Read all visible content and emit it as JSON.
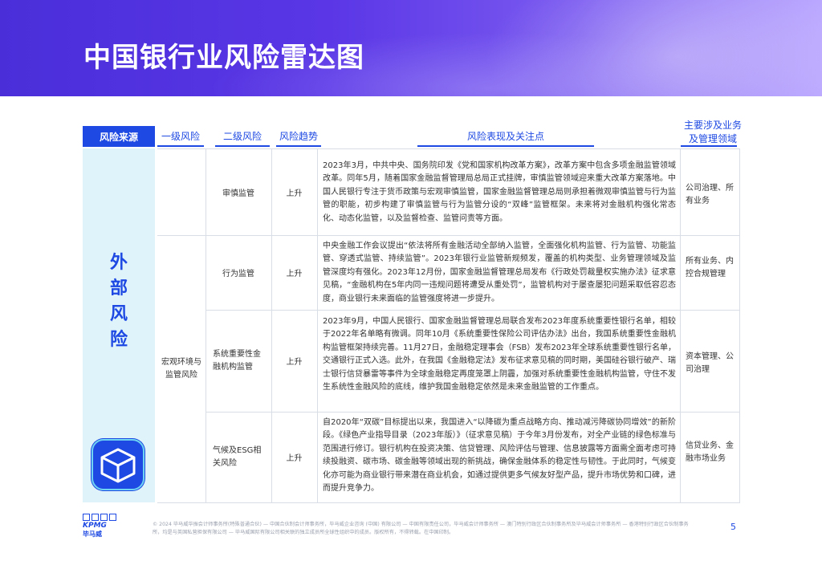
{
  "header": {
    "title": "中国银行业风险雷达图"
  },
  "table_headers": {
    "source": "风险来源",
    "level1": "一级风险",
    "level2": "二级风险",
    "trend": "风险趋势",
    "description": "风险表现及关注点",
    "areas_line1": "主要涉及业务",
    "areas_line2": "及管理领域"
  },
  "side": {
    "label": "外部风险",
    "icon": "cube-icon"
  },
  "level1_group": "宏观环境与监管风险",
  "rows": [
    {
      "level2": "审慎监管",
      "trend": "上升",
      "description": "2023年3月，中共中央、国务院印发《党和国家机构改革方案》，改革方案中包含多项金融监管领域改革。同年5月，随着国家金融监督管理局总局正式挂牌，审慎监管领域迎来重大改革方案落地。中国人民银行专注于货币政策与宏观审慎监管，国家金融监督管理总局则承担着微观审慎监管与行为监管的职能，初步构建了审慎监管与行为监管分设的“双峰”监管框架。未来将对金融机构强化常态化、动态化监管，以及监督检查、监管问责等方面。",
      "areas": "公司治理、所有业务"
    },
    {
      "level2": "行为监管",
      "trend": "上升",
      "description": "中央金融工作会议提出“依法将所有金融活动全部纳入监管，全面强化机构监管、行为监管、功能监管、穿透式监管、持续监管”。2023年银行业监管新规频发，覆盖的机构类型、业务管理领域及监管深度均有强化。2023年12月份，国家金融监督管理总局发布《行政处罚裁量权实施办法》征求意见稿，“金融机构在5年内同一违规问题将遭受从重处罚”，监管机构对于屡查屡犯问题采取低容忍态度，商业银行未来面临的监管强度将进一步提升。",
      "areas": "所有业务、内控合规管理"
    },
    {
      "level2": "系统重要性金融机构监管",
      "trend": "上升",
      "description": "2023年9月，中国人民银行、国家金融监督管理总局联合发布2023年度系统重要性银行名单，相较于2022年名单略有微调。同年10月《系统重要性保险公司评估办法》出台，我国系统重要性金融机构监管框架持续完善。11月27日，金融稳定理事会（FSB）发布2023年全球系统重要性银行名单，交通银行正式入选。此外，在我国《金融稳定法》发布征求意见稿的同时期，美国硅谷银行破产、瑞士银行信贷暴雷等事件为全球金融稳定再度笼罩上阴霾，加强对系统重要性金融机构监管，守住不发生系统性金融风险的底线，维护我国金融稳定依然是未来金融监管的工作重点。",
      "areas": "资本管理、公司治理"
    },
    {
      "level2": "气候及ESG相关风险",
      "trend": "上升",
      "description": "自2020年“双碳”目标提出以来，我国进入“以降碳为重点战略方向、推动减污降碳协同增效”的新阶段。《绿色产业指导目录（2023年版）》（征求意见稿）于今年3月份发布，对全产业链的绿色标准与范围进行修订。银行机构在投资决策、信贷管理、风险评估与管理、信息披露等方面需全面考虑可持续投融资、碳市场、碳金融等领域出现的新挑战，确保金融体系的稳定性与韧性。于此同时，气候变化亦可能为商业银行带来潜在商业机会，如通过提供更多气候友好型产品，提升市场优势和口碑，进而提升竞争力。",
      "areas": "信贷业务、金融市场业务"
    }
  ],
  "footer": {
    "logo_text": "KPMG",
    "logo_cn": "毕马威",
    "copyright": "© 2024 毕马威华振会计师事务所(特殊普通合伙) — 中国合伙制会计师事务所，毕马威企业咨询 (中国) 有限公司 — 中国有限责任公司，毕马威会计师事务所 — 澳门特别行政区合伙制事务所及毕马威会计师事务所 — 香港特别行政区合伙制事务所，均是与英国私营担保有限公司 — 毕马威国际有限公司相关联的独立成员所全球性组织中的成员。版权所有，不得转载。在中国印制。",
    "page": "5"
  },
  "colors": {
    "brand_blue": "#1e49e2",
    "side_band": "#dff3fb",
    "banner_start": "#4a2fd9"
  }
}
